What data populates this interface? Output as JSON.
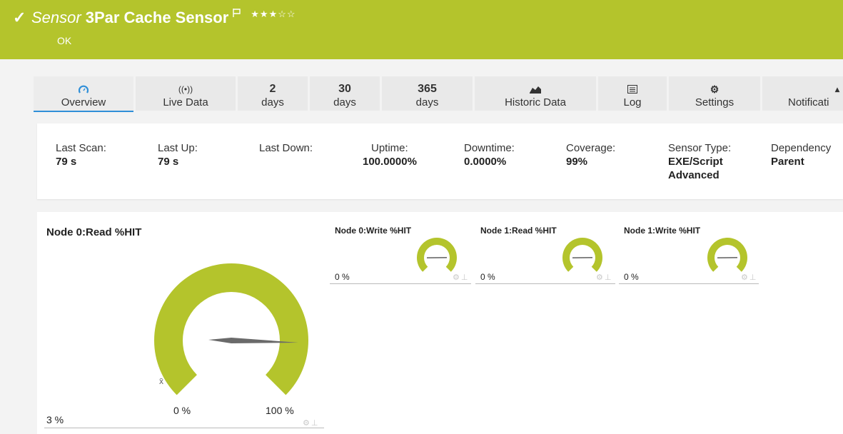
{
  "header": {
    "kind": "Sensor",
    "name": "3Par Cache Sensor",
    "status": "OK",
    "stars": "★★★☆☆",
    "bg_color": "#b4c42c",
    "icons": [
      "check-icon",
      "flag-icon"
    ]
  },
  "tabs": [
    {
      "top": "",
      "bottom": "Overview",
      "icon": "gauge-icon",
      "active": true
    },
    {
      "top": "",
      "bottom": "Live Data",
      "icon": "broadcast-icon",
      "active": false
    },
    {
      "top": "2",
      "bottom": "days",
      "active": false
    },
    {
      "top": "30",
      "bottom": "days",
      "active": false
    },
    {
      "top": "365",
      "bottom": "days",
      "active": false
    },
    {
      "top": "",
      "bottom": "Historic Data",
      "icon": "area-chart-icon",
      "active": false
    },
    {
      "top": "",
      "bottom": "Log",
      "icon": "list-icon",
      "active": false
    },
    {
      "top": "",
      "bottom": "Settings",
      "icon": "gear-icon",
      "active": false
    },
    {
      "top": "",
      "bottom": "Notificati",
      "icon": "bell-icon",
      "active": false
    }
  ],
  "info": [
    {
      "label": "Last Scan:",
      "value": "79 s"
    },
    {
      "label": "Last Up:",
      "value": "79 s"
    },
    {
      "label": "Last Down:",
      "value": ""
    },
    {
      "label": "Uptime:",
      "value": "100.0000%"
    },
    {
      "label": "Downtime:",
      "value": "0.0000%"
    },
    {
      "label": "Coverage:",
      "value": "99%"
    },
    {
      "label": "Sensor Type:",
      "value": "EXE/Script Advanced"
    },
    {
      "label": "Dependency",
      "value": "Parent"
    }
  ],
  "gauges": {
    "primary": {
      "title": "Node 0:Read %HIT",
      "value": "3 %",
      "min_label": "0 %",
      "max_label": "100 %",
      "avg_marker": "x̄",
      "needle_fraction": 0.84,
      "color": "#b4c42c"
    },
    "secondary": [
      {
        "title": "Node 0:Write %HIT",
        "value": "0 %",
        "needle_fraction": 0.83
      },
      {
        "title": "Node 1:Read %HIT",
        "value": "0 %",
        "needle_fraction": 0.83
      },
      {
        "title": "Node 1:Write %HIT",
        "value": "0 %",
        "needle_fraction": 0.83
      }
    ],
    "tool_icons": [
      "gear-icon",
      "pin-icon"
    ]
  }
}
